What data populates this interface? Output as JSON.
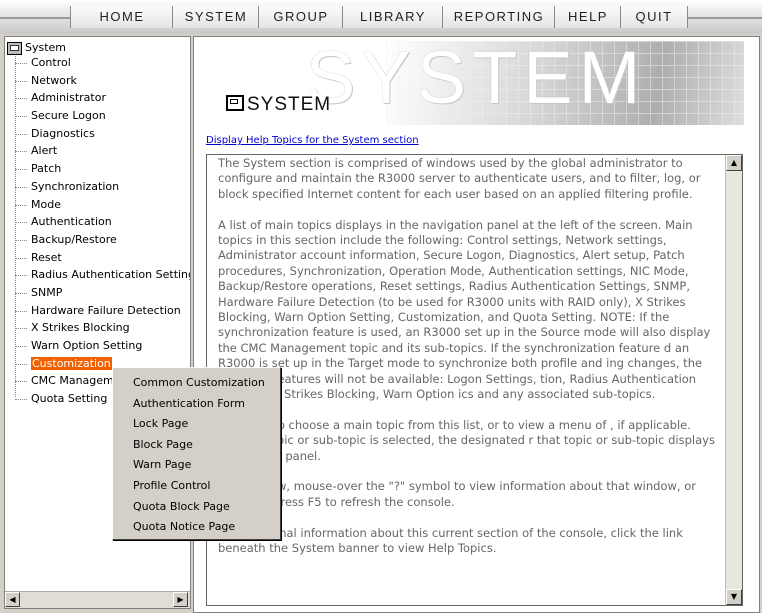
{
  "menu": [
    "HOME",
    "SYSTEM",
    "GROUP",
    "LIBRARY",
    "REPORTING",
    "HELP",
    "QUIT"
  ],
  "nav": {
    "root": "System",
    "items": [
      "Control",
      "Network",
      "Administrator",
      "Secure Logon",
      "Diagnostics",
      "Alert",
      "Patch",
      "Synchronization",
      "Mode",
      "Authentication",
      "Backup/Restore",
      "Reset",
      "Radius Authentication Setting",
      "SNMP",
      "Hardware Failure Detection",
      "X Strikes Blocking",
      "Warn Option Setting",
      "Customization",
      "CMC Managem",
      "Quota Setting"
    ],
    "selected": "Customization"
  },
  "banner": {
    "title": "SYSTEM",
    "watermark": "SYSTEM"
  },
  "help_link": "Display Help Topics for the System section",
  "paragraphs": [
    "The System section is comprised of windows used by the global administrator to configure and maintain the R3000 server to authenticate users, and to filter, log, or block specified Internet content for each user based on an applied filtering profile.",
    "A list of main topics displays in the navigation panel at the left of the screen. Main topics in this section include the following: Control settings, Network settings, Administrator account information, Secure Logon, Diagnostics, Alert setup, Patch procedures, Synchronization, Operation Mode, Authentication settings, NIC Mode, Backup/Restore operations, Reset settings, Radius Authentication Settings, SNMP, Hardware Failure Detection (to be used for R3000 units with RAID only), X Strikes Blocking, Warn Option Setting, Customization, and Quota Setting. NOTE: If the synchronization feature is used, an R3000 set up in the Source mode will also display the CMC Management topic and its sub-topics. If the synchronization feature d an R3000 is set up in the Target mode to synchronize both profile and ing changes, the following features will not be available: Logon Settings, tion, Radius Authentication Settings, X Strikes Blocking, Warn Option ics and any associated sub-topics.",
    "selection to choose a main topic from this list, or to view a menu of , if applicable. When a topic or sub-topic is selected, the designated r that topic or sub-topic displays in the right panel.",
    "any window, mouse-over the \"?\" symbol to view information about that window, or press F1. Press F5 to refresh the console.",
    "For additional information about this current section of the console, click the link beneath the System banner to view Help Topics."
  ],
  "popup": [
    "Common Customization",
    "Authentication Form",
    "Lock Page",
    "Block Page",
    "Warn Page",
    "Profile Control",
    "Quota Block Page",
    "Quota Notice Page"
  ],
  "colors": {
    "selected_bg": "#f26000",
    "link": "#0000cc"
  },
  "icons": {
    "root": "computer-icon",
    "scroll_up": "▲",
    "scroll_down": "▼",
    "scroll_left": "◀",
    "scroll_right": "▶"
  }
}
